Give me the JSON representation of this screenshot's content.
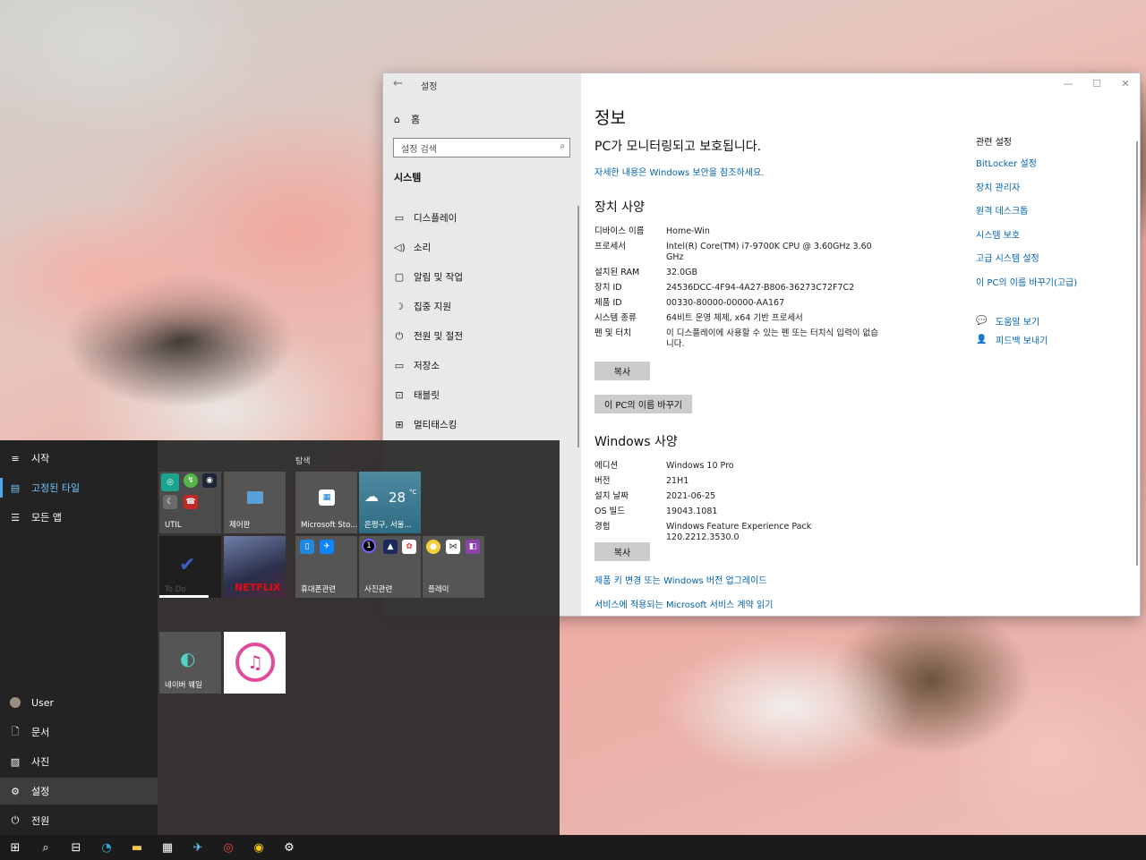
{
  "settings": {
    "title": "설정",
    "back": "←",
    "home": "홈",
    "search_placeholder": "설정 검색",
    "section": "시스템",
    "nav": [
      {
        "icon": "display-icon",
        "glyph": "▭",
        "label": "디스플레이"
      },
      {
        "icon": "sound-icon",
        "glyph": "◁)",
        "label": "소리"
      },
      {
        "icon": "notifications-icon",
        "glyph": "▢",
        "label": "알림 및 작업"
      },
      {
        "icon": "focus-assist-icon",
        "glyph": "☽",
        "label": "집중 지원"
      },
      {
        "icon": "power-icon",
        "glyph": "⏻",
        "label": "전원 및 절전"
      },
      {
        "icon": "storage-icon",
        "glyph": "▭",
        "label": "저장소"
      },
      {
        "icon": "tablet-icon",
        "glyph": "⊡",
        "label": "태블릿"
      },
      {
        "icon": "multitasking-icon",
        "glyph": "⊞",
        "label": "멀티태스킹"
      }
    ],
    "controls": {
      "minimize": "—",
      "maximize": "☐",
      "close": "✕"
    }
  },
  "about": {
    "title": "정보",
    "protected": "PC가 모니터링되고 보호됩니다.",
    "security_link": "자세한 내용은 Windows 보안을 참조하세요.",
    "device_specs_title": "장치 사양",
    "device_specs": [
      {
        "k": "디바이스 이름",
        "v": "Home-Win"
      },
      {
        "k": "프로세서",
        "v": "Intel(R) Core(TM) i7-9700K CPU @ 3.60GHz   3.60 GHz"
      },
      {
        "k": "설치된 RAM",
        "v": "32.0GB"
      },
      {
        "k": "장치 ID",
        "v": "24536DCC-4F94-4A27-B806-36273C72F7C2"
      },
      {
        "k": "제품 ID",
        "v": "00330-80000-00000-AA167"
      },
      {
        "k": "시스템 종류",
        "v": "64비트 운영 체제, x64 기반 프로세서"
      },
      {
        "k": "펜 및 터치",
        "v": "이 디스플레이에 사용할 수 있는 펜 또는 터치식 입력이 없습니다."
      }
    ],
    "copy_label": "복사",
    "rename_label": "이 PC의 이름 바꾸기",
    "windows_specs_title": "Windows 사양",
    "windows_specs": [
      {
        "k": "에디션",
        "v": "Windows 10 Pro"
      },
      {
        "k": "버전",
        "v": "21H1"
      },
      {
        "k": "설치 날짜",
        "v": "2021-06-25"
      },
      {
        "k": "OS 빌드",
        "v": "19043.1081"
      },
      {
        "k": "경험",
        "v": "Windows Feature Experience Pack 120.2212.3530.0"
      }
    ],
    "upgrade_link": "제품 키 변경 또는 Windows 버전 업그레이드",
    "agreement_link": "서비스에 적용되는 Microsoft 서비스 계약 읽기"
  },
  "related": {
    "title": "관련 설정",
    "links": [
      "BitLocker 설정",
      "장치 관리자",
      "원격 데스크톱",
      "시스템 보호",
      "고급 시스템 설정",
      "이 PC의 이름 바꾸기(고급)"
    ],
    "help": "도움말 보기",
    "feedback": "피드백 보내기"
  },
  "start": {
    "title": "시작",
    "pinned": "고정된 타일",
    "all_apps": "모든 앱",
    "user": "User",
    "documents": "문서",
    "pictures": "사진",
    "settings": "설정",
    "power": "전원",
    "group": "탐색",
    "tiles": {
      "util": "UTIL",
      "control_panel": "제어판",
      "store": "Microsoft Sto...",
      "weather_temp": "28",
      "weather_unit": "°C",
      "weather_loc": "은평구, 서울...",
      "todo": "To Do",
      "netflix": "NETFLIX",
      "phone": "휴대폰관련",
      "photo": "사진관련",
      "play": "플레이",
      "whale": "네이버 웨일"
    }
  },
  "colors": {
    "link": "#0063b1",
    "accent": "#4aa9f0",
    "netflix": "#e50914"
  }
}
